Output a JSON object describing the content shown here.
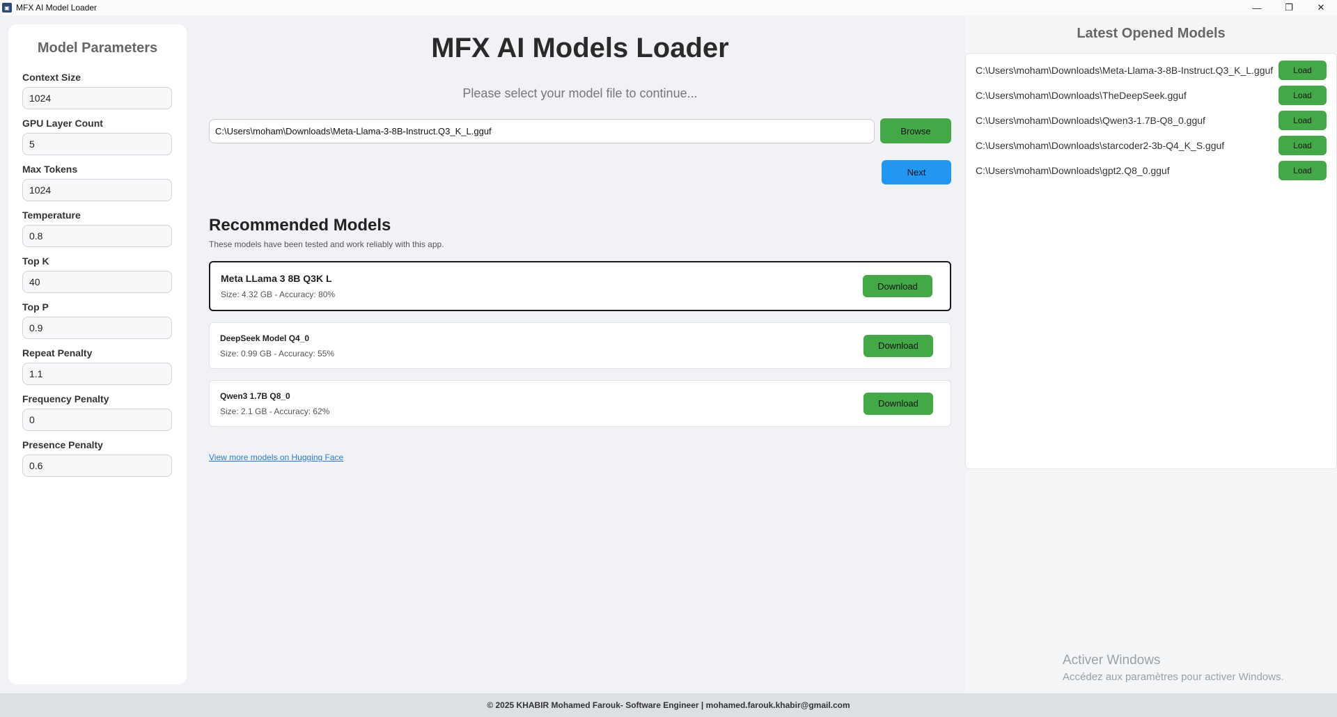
{
  "window": {
    "title": "MFX AI Model Loader",
    "controls": {
      "minimize": "—",
      "maximize": "❐",
      "close": "✕"
    }
  },
  "sidebar": {
    "title": "Model Parameters",
    "params": [
      {
        "label": "Context Size",
        "value": "1024"
      },
      {
        "label": "GPU Layer Count",
        "value": "5"
      },
      {
        "label": "Max Tokens",
        "value": "1024"
      },
      {
        "label": "Temperature",
        "value": "0.8"
      },
      {
        "label": "Top K",
        "value": "40"
      },
      {
        "label": "Top P",
        "value": "0.9"
      },
      {
        "label": "Repeat Penalty",
        "value": "1.1"
      },
      {
        "label": "Frequency Penalty",
        "value": "0"
      },
      {
        "label": "Presence Penalty",
        "value": "0.6"
      }
    ]
  },
  "main": {
    "title": "MFX AI Models Loader",
    "subtitle": "Please select your model file to continue...",
    "file_path": "C:\\Users\\moham\\Downloads\\Meta-Llama-3-8B-Instruct.Q3_K_L.gguf",
    "browse_label": "Browse",
    "next_label": "Next",
    "recommended_title": "Recommended Models",
    "recommended_desc": "These models have been tested and work reliably with this app.",
    "models": [
      {
        "name": "Meta LLama 3 8B Q3K L",
        "meta": "Size: 4.32 GB - Accuracy: 80%",
        "button": "Download"
      },
      {
        "name": "DeepSeek Model Q4_0",
        "meta": "Size: 0.99 GB - Accuracy: 55%",
        "button": "Download"
      },
      {
        "name": "Qwen3 1.7B Q8_0",
        "meta": "Size: 2.1 GB - Accuracy: 62%",
        "button": "Download"
      }
    ],
    "more_link": "View more models on Hugging Face"
  },
  "recent": {
    "title": "Latest Opened Models",
    "items": [
      {
        "path": "C:\\Users\\moham\\Downloads\\Meta-Llama-3-8B-Instruct.Q3_K_L.gguf",
        "button": "Load"
      },
      {
        "path": "C:\\Users\\moham\\Downloads\\TheDeepSeek.gguf",
        "button": "Load"
      },
      {
        "path": "C:\\Users\\moham\\Downloads\\Qwen3-1.7B-Q8_0.gguf",
        "button": "Load"
      },
      {
        "path": "C:\\Users\\moham\\Downloads\\starcoder2-3b-Q4_K_S.gguf",
        "button": "Load"
      },
      {
        "path": "C:\\Users\\moham\\Downloads\\gpt2.Q8_0.gguf",
        "button": "Load"
      }
    ]
  },
  "watermark": {
    "title": "Activer Windows",
    "subtitle": "Accédez aux paramètres pour activer Windows."
  },
  "footer": {
    "text": "© 2025 KHABIR Mohamed Farouk- Software Engineer | mohamed.farouk.khabir@gmail.com"
  },
  "colors": {
    "green_button": "#43a947",
    "blue_button": "#2196f3",
    "link": "#2b7bd6"
  }
}
